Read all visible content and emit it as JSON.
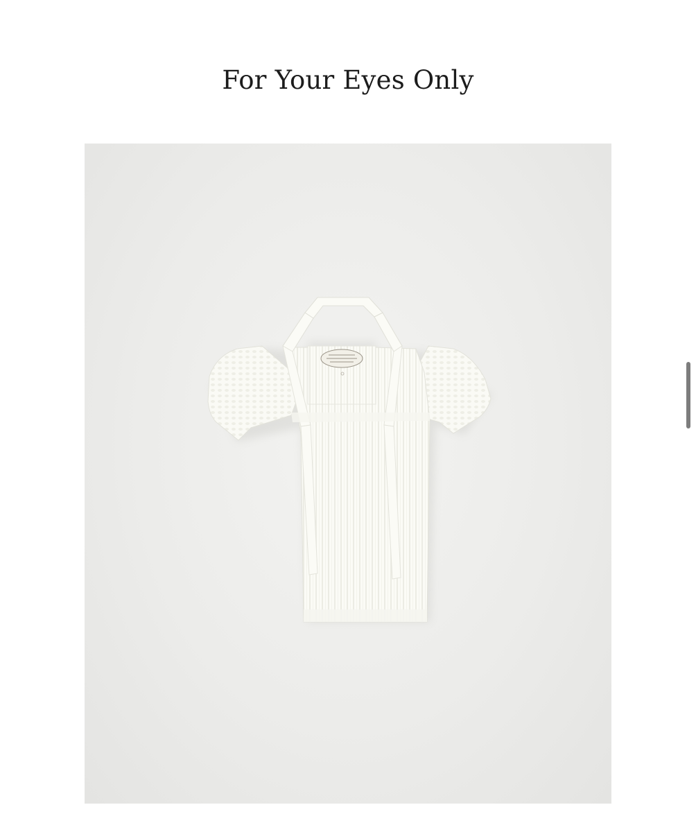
{
  "header": {
    "brand_title": "For Your Eyes Only"
  },
  "product": {
    "image_alt": "white ribbed knit short-sleeve top with halter tie straps",
    "garment_color": "#fbfbf6",
    "background_color": "#ececea"
  },
  "scrollbar": {
    "thumb_color": "#7d7d7d"
  }
}
